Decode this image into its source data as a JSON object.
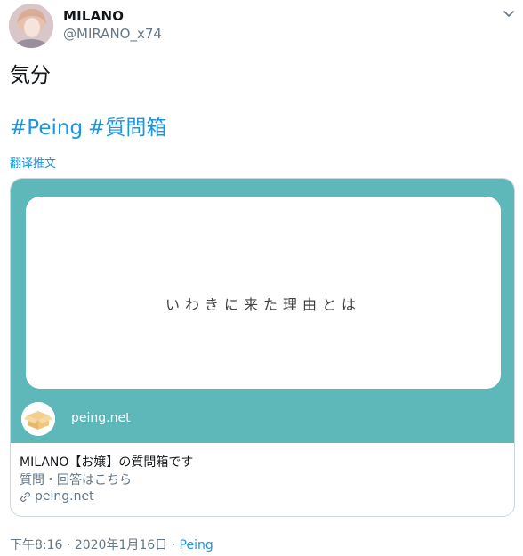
{
  "user": {
    "display_name": "MILANO",
    "handle": "@MIRANO_x74"
  },
  "tweet": {
    "text": "気分",
    "hashtags": [
      "#Peing",
      "#質問箱"
    ],
    "translate_label": "翻译推文"
  },
  "card": {
    "image_text": "いわきに来た理由とは",
    "image_domain": "peing.net",
    "title": "MILANO【お嬢】の質問箱です",
    "description": "質問・回答はこちら",
    "link": "peing.net",
    "colors": {
      "background": "#5eb7b8"
    }
  },
  "footer": {
    "time": "下午8:16",
    "separator1": " · ",
    "date": "2020年1月16日",
    "separator2": " · ",
    "source": "Peing"
  },
  "icons": {
    "menu": "chevron-down-icon",
    "link": "link-icon",
    "logo": "peing-box-logo"
  }
}
